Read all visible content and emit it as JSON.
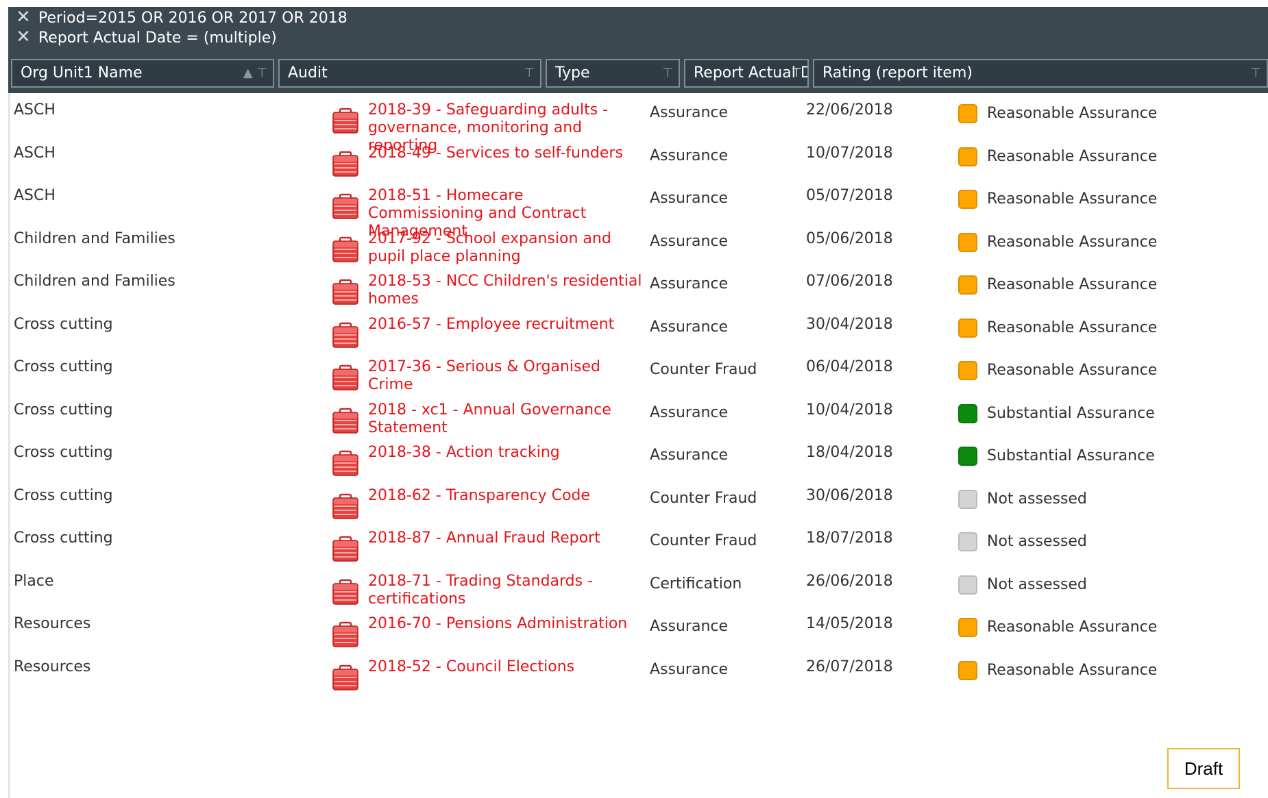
{
  "filters": {
    "period": "Period=2015 OR 2016 OR 2017 OR 2018",
    "report_date": "Report Actual Date = (multiple)"
  },
  "headers": {
    "org": "Org Unit1 Name",
    "audit": "Audit",
    "type": "Type",
    "date": "Report Actual D",
    "rating": "Rating (report item)"
  },
  "colors": {
    "reasonable": "#ffa500",
    "substantial": "#0b8a0b",
    "not_assessed": "#d4d4d4",
    "link": "#e8141a",
    "header_bg": "#3b484f"
  },
  "rows": [
    {
      "org": "ASCH",
      "audit": "2018-39 - Safeguarding adults - governance, monitoring and reporting",
      "type": "Assurance",
      "date": "22/06/2018",
      "rating": "Reasonable Assurance",
      "rating_key": "reasonable"
    },
    {
      "org": "ASCH",
      "audit": "2018-49 - Services to self-funders",
      "type": "Assurance",
      "date": "10/07/2018",
      "rating": "Reasonable Assurance",
      "rating_key": "reasonable"
    },
    {
      "org": "ASCH",
      "audit": "2018-51 - Homecare Commissioning and Contract Management",
      "type": "Assurance",
      "date": "05/07/2018",
      "rating": "Reasonable Assurance",
      "rating_key": "reasonable"
    },
    {
      "org": "Children and Families",
      "audit": "2017-92 - School expansion and pupil place planning",
      "type": "Assurance",
      "date": "05/06/2018",
      "rating": "Reasonable Assurance",
      "rating_key": "reasonable"
    },
    {
      "org": "Children and Families",
      "audit": "2018-53 - NCC Children's residential homes",
      "type": "Assurance",
      "date": "07/06/2018",
      "rating": "Reasonable Assurance",
      "rating_key": "reasonable"
    },
    {
      "org": "Cross cutting",
      "audit": "2016-57 - Employee recruitment",
      "type": "Assurance",
      "date": "30/04/2018",
      "rating": "Reasonable Assurance",
      "rating_key": "reasonable"
    },
    {
      "org": "Cross cutting",
      "audit": "2017-36 - Serious & Organised Crime",
      "type": "Counter Fraud",
      "date": "06/04/2018",
      "rating": "Reasonable Assurance",
      "rating_key": "reasonable"
    },
    {
      "org": "Cross cutting",
      "audit": "2018 - xc1 - Annual Governance Statement",
      "type": "Assurance",
      "date": "10/04/2018",
      "rating": "Substantial Assurance",
      "rating_key": "substantial"
    },
    {
      "org": "Cross cutting",
      "audit": "2018-38 - Action tracking",
      "type": "Assurance",
      "date": "18/04/2018",
      "rating": "Substantial Assurance",
      "rating_key": "substantial"
    },
    {
      "org": "Cross cutting",
      "audit": "2018-62 - Transparency Code",
      "type": "Counter Fraud",
      "date": "30/06/2018",
      "rating": "Not assessed",
      "rating_key": "not_assessed"
    },
    {
      "org": "Cross cutting",
      "audit": "2018-87 - Annual Fraud Report",
      "type": "Counter Fraud",
      "date": "18/07/2018",
      "rating": "Not assessed",
      "rating_key": "not_assessed"
    },
    {
      "org": "Place",
      "audit": "2018-71 - Trading Standards - certifications",
      "type": "Certification",
      "date": "26/06/2018",
      "rating": "Not assessed",
      "rating_key": "not_assessed"
    },
    {
      "org": "Resources",
      "audit": "2016-70 - Pensions Administration",
      "type": "Assurance",
      "date": "14/05/2018",
      "rating": "Reasonable Assurance",
      "rating_key": "reasonable"
    },
    {
      "org": "Resources",
      "audit": "2018-52 - Council Elections",
      "type": "Assurance",
      "date": "26/07/2018",
      "rating": "Reasonable Assurance",
      "rating_key": "reasonable"
    }
  ],
  "watermark": "Draft"
}
